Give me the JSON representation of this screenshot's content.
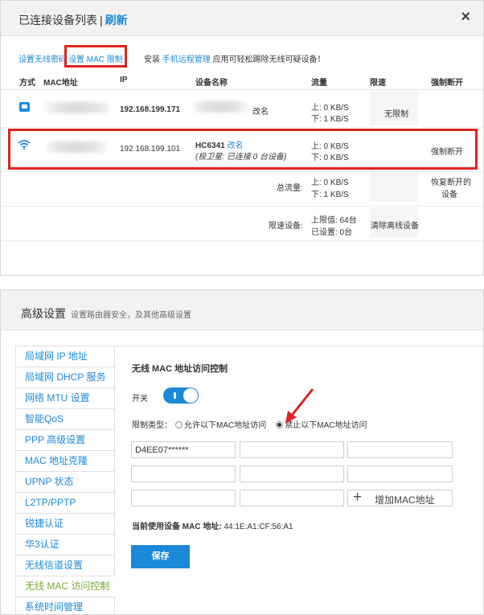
{
  "device_list": {
    "title": "已连接设备列表",
    "separator": "|",
    "refresh": "刷新",
    "close": "×",
    "links": {
      "wifi_password": "设置无线密码",
      "mac_limit": "设置 MAC 限制",
      "promo_prefix": "安装",
      "promo_link": "手机远程管理",
      "promo_suffix": "应用可轻松踢除无线可疑设备！"
    },
    "columns": [
      "方式",
      "MAC地址",
      "IP",
      "设备名称",
      "流量",
      "限速",
      "强制断开"
    ],
    "rows": [
      {
        "type": "lan-icon",
        "ip": "192.168.199.171",
        "rename": "改名",
        "traffic_up": "上: 0 KB/S",
        "traffic_down": "下: 1 KB/S",
        "limit": "无限制",
        "action": ""
      },
      {
        "type": "wifi-icon",
        "ip": "192.168.199.101",
        "name": "HC6341",
        "rename": "改名",
        "note": "(极卫星: 已连接 0 台设备)",
        "traffic_up": "上: 0 KB/S",
        "traffic_down": "下: 0 KB/S",
        "limit": "",
        "action": "强制断开"
      }
    ],
    "total": {
      "label": "总流量:",
      "up": "上: 0 KB/S",
      "down": "下: 1 KB/S",
      "restore_line1": "恢复断开的",
      "restore_line2": "设备"
    },
    "speed_limit": {
      "label": "限速设备:",
      "max": "上限值: 64台",
      "set": "已设置: 0台",
      "clear": "清除离线设备"
    }
  },
  "advanced": {
    "title": "高级设置",
    "subtitle": "设置路由器安全，及其他高级设置",
    "sidebar": [
      "局域网 IP 地址",
      "局域网 DHCP 服务",
      "网络 MTU 设置",
      "智能QoS",
      "PPP 高级设置",
      "MAC 地址克隆",
      "UPNP 状态",
      "L2TP/PPTP",
      "锐捷认证",
      "华3认证",
      "无线信道设置",
      "无线 MAC 访问控制",
      "系统时间管理"
    ],
    "active_item": "无线 MAC 访问控制",
    "section_title": "无线 MAC 地址访问控制",
    "switch_label": "开关",
    "switch_on": true,
    "limit_type_label": "限制类型：",
    "option_allow": "允许以下MAC地址访问",
    "option_deny": "禁止以下MAC地址访问",
    "selected_option": "禁止以下MAC地址访问",
    "mac_entries": [
      "D4EE07******",
      "",
      "",
      "",
      "",
      "",
      "",
      ""
    ],
    "add_mac": "增加MAC地址",
    "current_mac_label": "当前使用设备 MAC 地址:",
    "current_mac_value": "44:1E:A1:CF:56:A1",
    "save": "保存"
  },
  "colors": {
    "accent": "#1a8ad8",
    "highlight": "#e0231f",
    "active_menu": "#7aa832"
  }
}
